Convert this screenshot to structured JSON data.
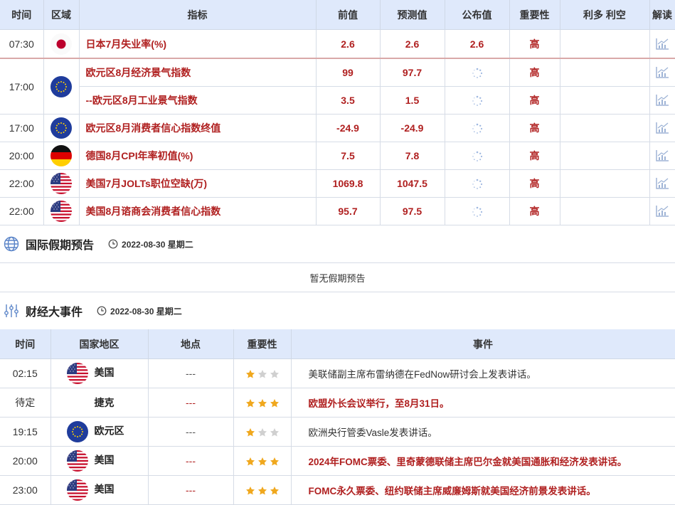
{
  "econ_table": {
    "headers": [
      "时间",
      "区域",
      "指标",
      "前值",
      "预测值",
      "公布值",
      "重要性",
      "利多 利空",
      "解读"
    ],
    "rows": [
      {
        "time": "07:30",
        "flag": "japan-flag-icon",
        "name": "日本7月失业率(%)",
        "prev": "2.6",
        "forecast": "2.6",
        "actual": "2.6",
        "importance": "高"
      },
      {
        "time": "17:00",
        "flag": "eu-flag-icon",
        "name": "欧元区8月经济景气指数",
        "prev": "99",
        "forecast": "97.7",
        "actual": "",
        "importance": "高"
      },
      {
        "time": "",
        "flag": "",
        "name": "--欧元区8月工业景气指数",
        "prev": "3.5",
        "forecast": "1.5",
        "actual": "",
        "importance": "高"
      },
      {
        "time": "17:00",
        "flag": "eu-flag-icon",
        "name": "欧元区8月消费者信心指数终值",
        "prev": "-24.9",
        "forecast": "-24.9",
        "actual": "",
        "importance": "高"
      },
      {
        "time": "20:00",
        "flag": "germany-flag-icon",
        "name": "德国8月CPI年率初值(%)",
        "prev": "7.5",
        "forecast": "7.8",
        "actual": "",
        "importance": "高"
      },
      {
        "time": "22:00",
        "flag": "usa-flag-icon",
        "name": "美国7月JOLTs职位空缺(万)",
        "prev": "1069.8",
        "forecast": "1047.5",
        "actual": "",
        "importance": "高"
      },
      {
        "time": "22:00",
        "flag": "usa-flag-icon",
        "name": "美国8月谘商会消费者信心指数",
        "prev": "95.7",
        "forecast": "97.5",
        "actual": "",
        "importance": "高"
      }
    ]
  },
  "holiday": {
    "title": "国际假期预告",
    "date": "2022-08-30 星期二",
    "empty_text": "暂无假期预告"
  },
  "events": {
    "title": "财经大事件",
    "date": "2022-08-30 星期二",
    "headers": [
      "时间",
      "国家地区",
      "地点",
      "重要性",
      "事件"
    ],
    "rows": [
      {
        "time": "02:15",
        "flag": "usa-flag-icon",
        "country": "美国",
        "place": "---",
        "stars": 1,
        "event": "美联储副主席布雷纳德在FedNow研讨会上发表讲话。",
        "highlight": false
      },
      {
        "time": "待定",
        "flag": "",
        "country": "捷克",
        "place": "---",
        "stars": 3,
        "event": "欧盟外长会议举行，至8月31日。",
        "highlight": true
      },
      {
        "time": "19:15",
        "flag": "eu-flag-icon",
        "country": "欧元区",
        "place": "---",
        "stars": 1,
        "event": "欧洲央行管委Vasle发表讲话。",
        "highlight": false
      },
      {
        "time": "20:00",
        "flag": "usa-flag-icon",
        "country": "美国",
        "place": "---",
        "stars": 3,
        "event": "2024年FOMC票委、里奇蒙德联储主席巴尔金就美国通胀和经济发表讲话。",
        "highlight": true
      },
      {
        "time": "23:00",
        "flag": "usa-flag-icon",
        "country": "美国",
        "place": "---",
        "stars": 3,
        "event": "FOMC永久票委、纽约联储主席威廉姆斯就美国经济前景发表讲话。",
        "highlight": true
      }
    ]
  },
  "colors": {
    "accent_red": "#b02020",
    "header_bg": "#dfe9fb",
    "star_gold": "#f0a81e",
    "star_gray": "#d0d0d0"
  }
}
